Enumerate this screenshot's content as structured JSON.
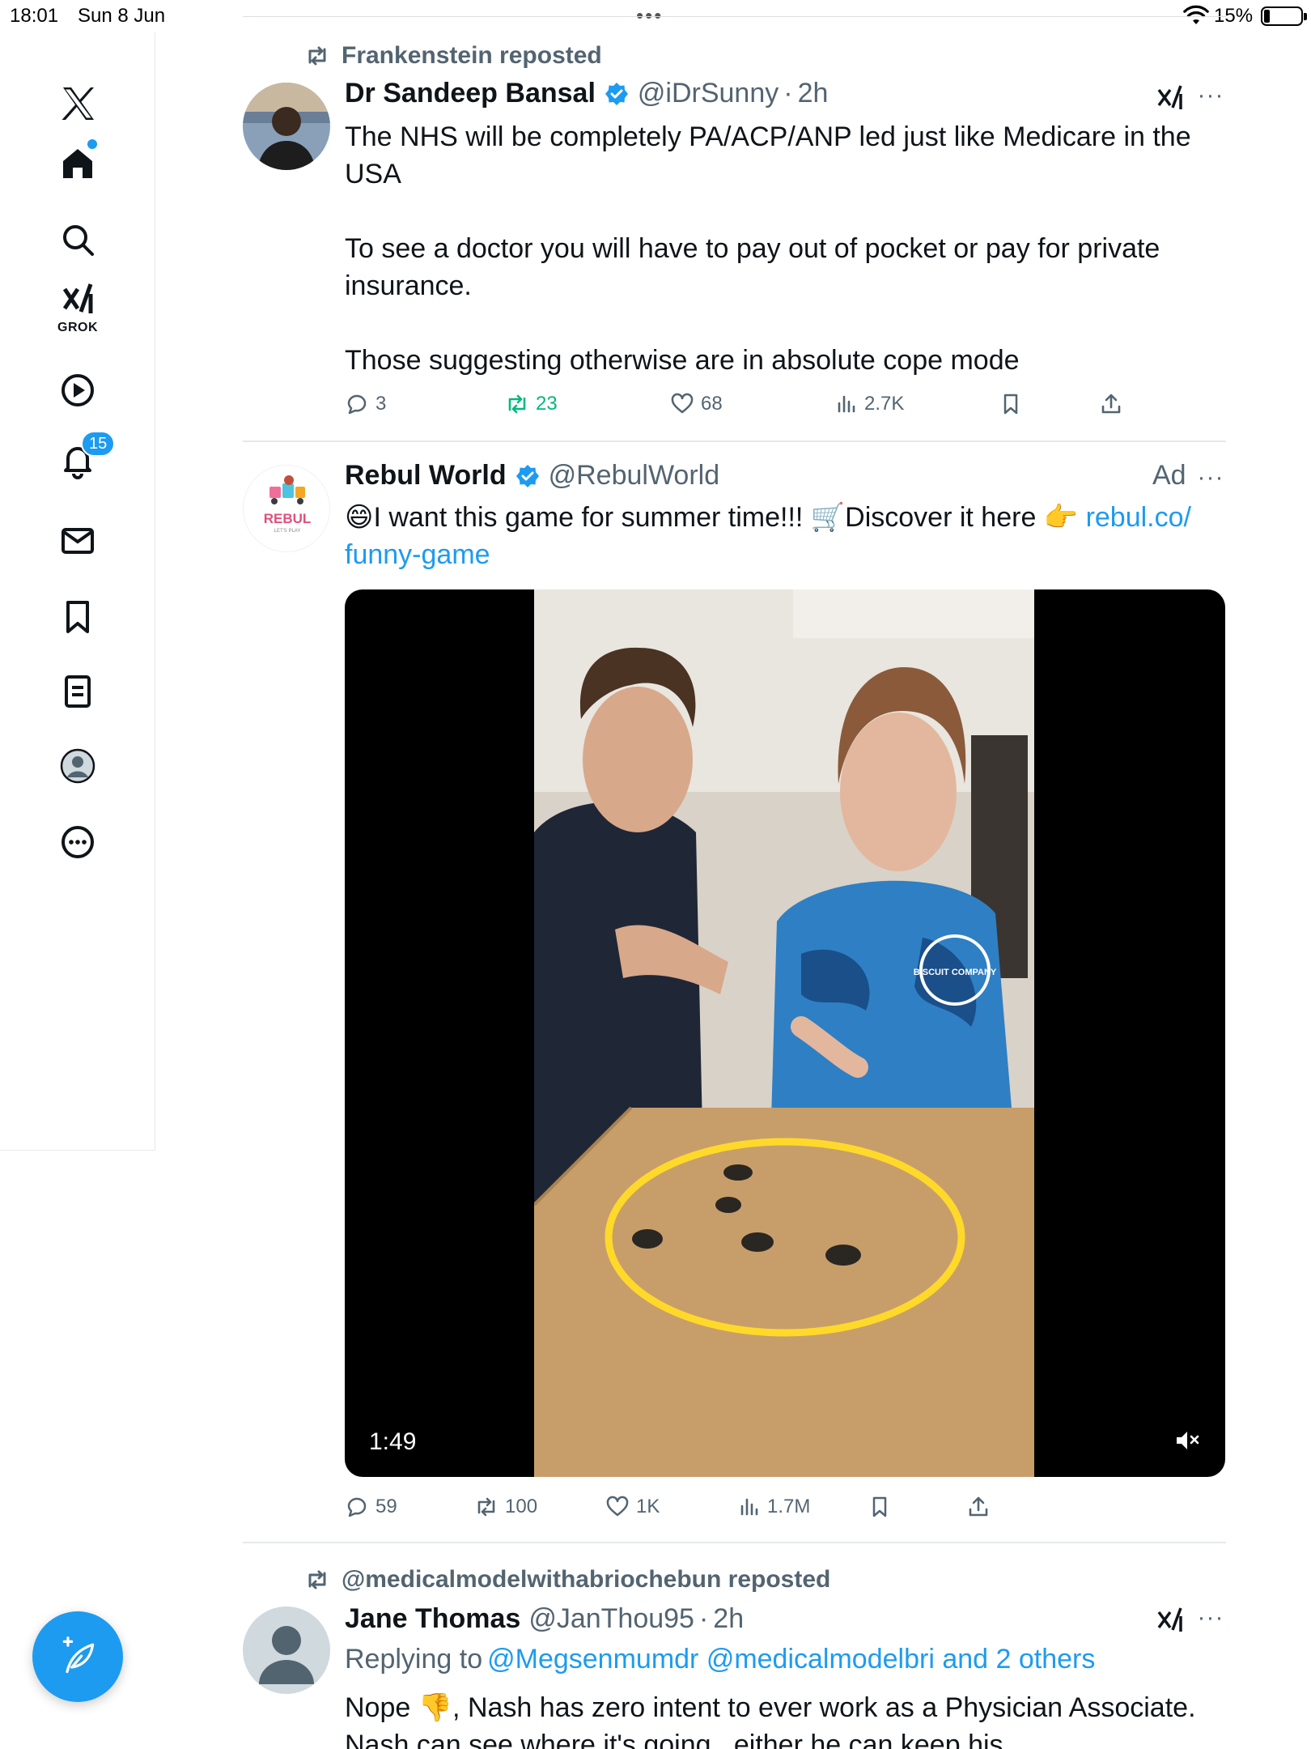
{
  "status_bar": {
    "time": "18:01",
    "date": "Sun 8 Jun",
    "battery": "15%",
    "battery_level": 0.15
  },
  "sidebar": {
    "grok_label": "GROK",
    "notifications_badge": "15"
  },
  "colors": {
    "accent": "#1d9bf0",
    "text_primary": "#0f1419",
    "text_secondary": "#536471",
    "repost_active": "#00ba7c"
  },
  "posts": [
    {
      "repost_label": "Frankenstein reposted",
      "name": "Dr Sandeep Bansal",
      "handle": "@iDrSunny",
      "separator": "·",
      "time": "2h",
      "text": "The NHS will be completely PA/ACP/ANP led just like Medicare in the USA\n\nTo see a doctor you will have to pay out of pocket or pay for private insurance.\n\nThose suggesting otherwise are in absolute cope mode",
      "stats": {
        "replies": "3",
        "reposts": "23",
        "likes": "68",
        "views": "2.7K"
      }
    },
    {
      "name": "Rebul World",
      "handle": "@RebulWorld",
      "ad_label": "Ad",
      "avatar_text": "REBUL",
      "avatar_subtext": "LET'S PLAY",
      "text_prefix": "😄I want this game for summer time!!! 🛒Discover it here 👉 ",
      "link_line1": "rebul.co/",
      "link_line2": "funny-game",
      "video_duration": "1:49",
      "video_shirt_text": "BISCUIT COMPANY",
      "stats": {
        "replies": "59",
        "reposts": "100",
        "likes": "1K",
        "views": "1.7M"
      }
    },
    {
      "repost_label": "@medicalmodelwithabriochebun reposted",
      "name": "Jane Thomas",
      "handle": "@JanThou95",
      "separator": "·",
      "time": "2h",
      "replying_prefix": "Replying to",
      "replying_targets": "@Megsenmumdr @medicalmodelbri and 2 others",
      "text": "Nope 👎, Nash has zero intent to ever work as a Physician Associate. Nash can see where it's going...either he can keep his"
    }
  ]
}
